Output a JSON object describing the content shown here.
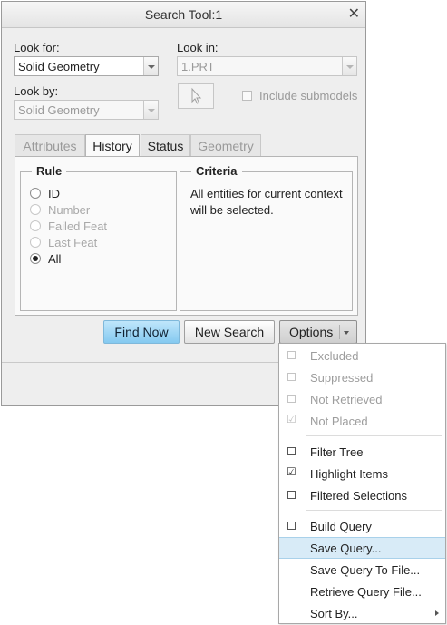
{
  "window": {
    "title": "Search Tool:1",
    "close_glyph": "✕"
  },
  "look_for": {
    "label": "Look for:",
    "value": "Solid Geometry"
  },
  "look_in": {
    "label": "Look in:",
    "value": "1.PRT"
  },
  "look_by": {
    "label": "Look by:",
    "value": "Solid Geometry"
  },
  "include_submodels": {
    "label": "Include submodels",
    "checked": false
  },
  "tabs": [
    {
      "label": "Attributes",
      "state": "disabled"
    },
    {
      "label": "History",
      "state": "active"
    },
    {
      "label": "Status",
      "state": "enabled"
    },
    {
      "label": "Geometry",
      "state": "disabled"
    }
  ],
  "rule": {
    "title": "Rule",
    "options": [
      {
        "label": "ID",
        "enabled": true,
        "selected": false
      },
      {
        "label": "Number",
        "enabled": false,
        "selected": false
      },
      {
        "label": "Failed Feat",
        "enabled": false,
        "selected": false
      },
      {
        "label": "Last Feat",
        "enabled": false,
        "selected": false
      },
      {
        "label": "All",
        "enabled": true,
        "selected": true
      }
    ]
  },
  "criteria": {
    "title": "Criteria",
    "text": "All entities for current context will be selected."
  },
  "buttons": {
    "find_now": "Find Now",
    "new_search": "New Search",
    "options": "Options"
  },
  "options_menu": {
    "items": [
      {
        "label": "Excluded",
        "enabled": false,
        "checked": false
      },
      {
        "label": "Suppressed",
        "enabled": false,
        "checked": false
      },
      {
        "label": "Not Retrieved",
        "enabled": false,
        "checked": false
      },
      {
        "label": "Not Placed",
        "enabled": false,
        "checked": true
      },
      {
        "label": "Filter Tree",
        "enabled": true,
        "checked": false
      },
      {
        "label": "Highlight Items",
        "enabled": true,
        "checked": true
      },
      {
        "label": "Filtered Selections",
        "enabled": true,
        "checked": false
      },
      {
        "label": "Build Query",
        "enabled": true,
        "checked": false
      },
      {
        "label": "Save Query...",
        "enabled": true,
        "highlighted": true
      },
      {
        "label": "Save Query To File...",
        "enabled": true
      },
      {
        "label": "Retrieve Query File...",
        "enabled": true
      },
      {
        "label": "Sort By...",
        "enabled": true,
        "submenu": true
      }
    ]
  },
  "colors": {
    "primary_button": "#84c9f0",
    "menu_highlight": "#d8ebf7",
    "window_bg": "#eeeeee"
  }
}
